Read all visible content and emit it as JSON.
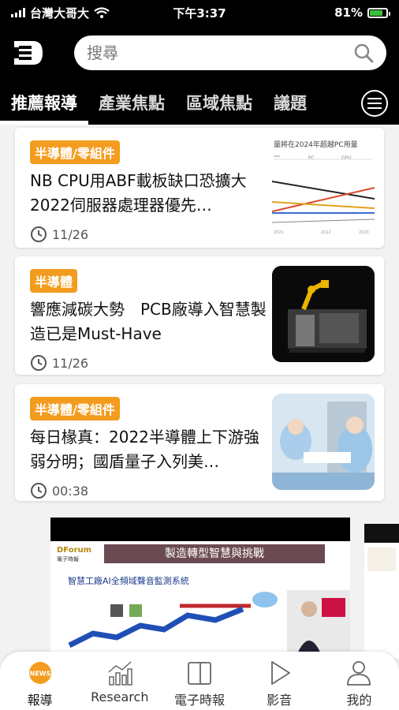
{
  "status_bar": {
    "carrier": "台灣大哥大",
    "time": "下午3:37",
    "battery": "81%",
    "battery_level": 0.81
  },
  "search": {
    "placeholder": "搜尋"
  },
  "tabs": [
    {
      "label": "推薦報導",
      "active": true
    },
    {
      "label": "產業焦點",
      "active": false
    },
    {
      "label": "區域焦點",
      "active": false
    },
    {
      "label": "議題",
      "active": false
    }
  ],
  "articles": [
    {
      "category": "半導體/零組件",
      "title": "NB CPU用ABF載板缺口恐擴大　2022伺服器處理器優先…",
      "time": "11/26",
      "thumb_title": "量將在2024年超越PC用量"
    },
    {
      "category": "半導體",
      "title": "響應減碳大勢　PCB廠導入智慧製造已是Must-Have",
      "time": "11/26"
    },
    {
      "category": "半導體/零組件",
      "title": "每日椽真：2022半導體上下游強弱分明；國盾量子入列美…",
      "time": "00:38"
    }
  ],
  "video": {
    "brand": "DForum",
    "brand_sub": "電子時報",
    "banner": "製造轉型智慧與挑戰",
    "slide_title": "智慧工廠AI全頻域聲音監測系統"
  },
  "bottom_nav": [
    {
      "label": "報導",
      "icon": "news-icon",
      "active": true
    },
    {
      "label": "Research",
      "icon": "research-chart-icon",
      "active": false
    },
    {
      "label": "電子時報",
      "icon": "e-paper-icon",
      "active": false
    },
    {
      "label": "影音",
      "icon": "play-icon",
      "active": false
    },
    {
      "label": "我的",
      "icon": "user-icon",
      "active": false
    }
  ],
  "colors": {
    "accent": "#f39c1f",
    "bar": "#000000",
    "background": "#f2f2f2"
  }
}
